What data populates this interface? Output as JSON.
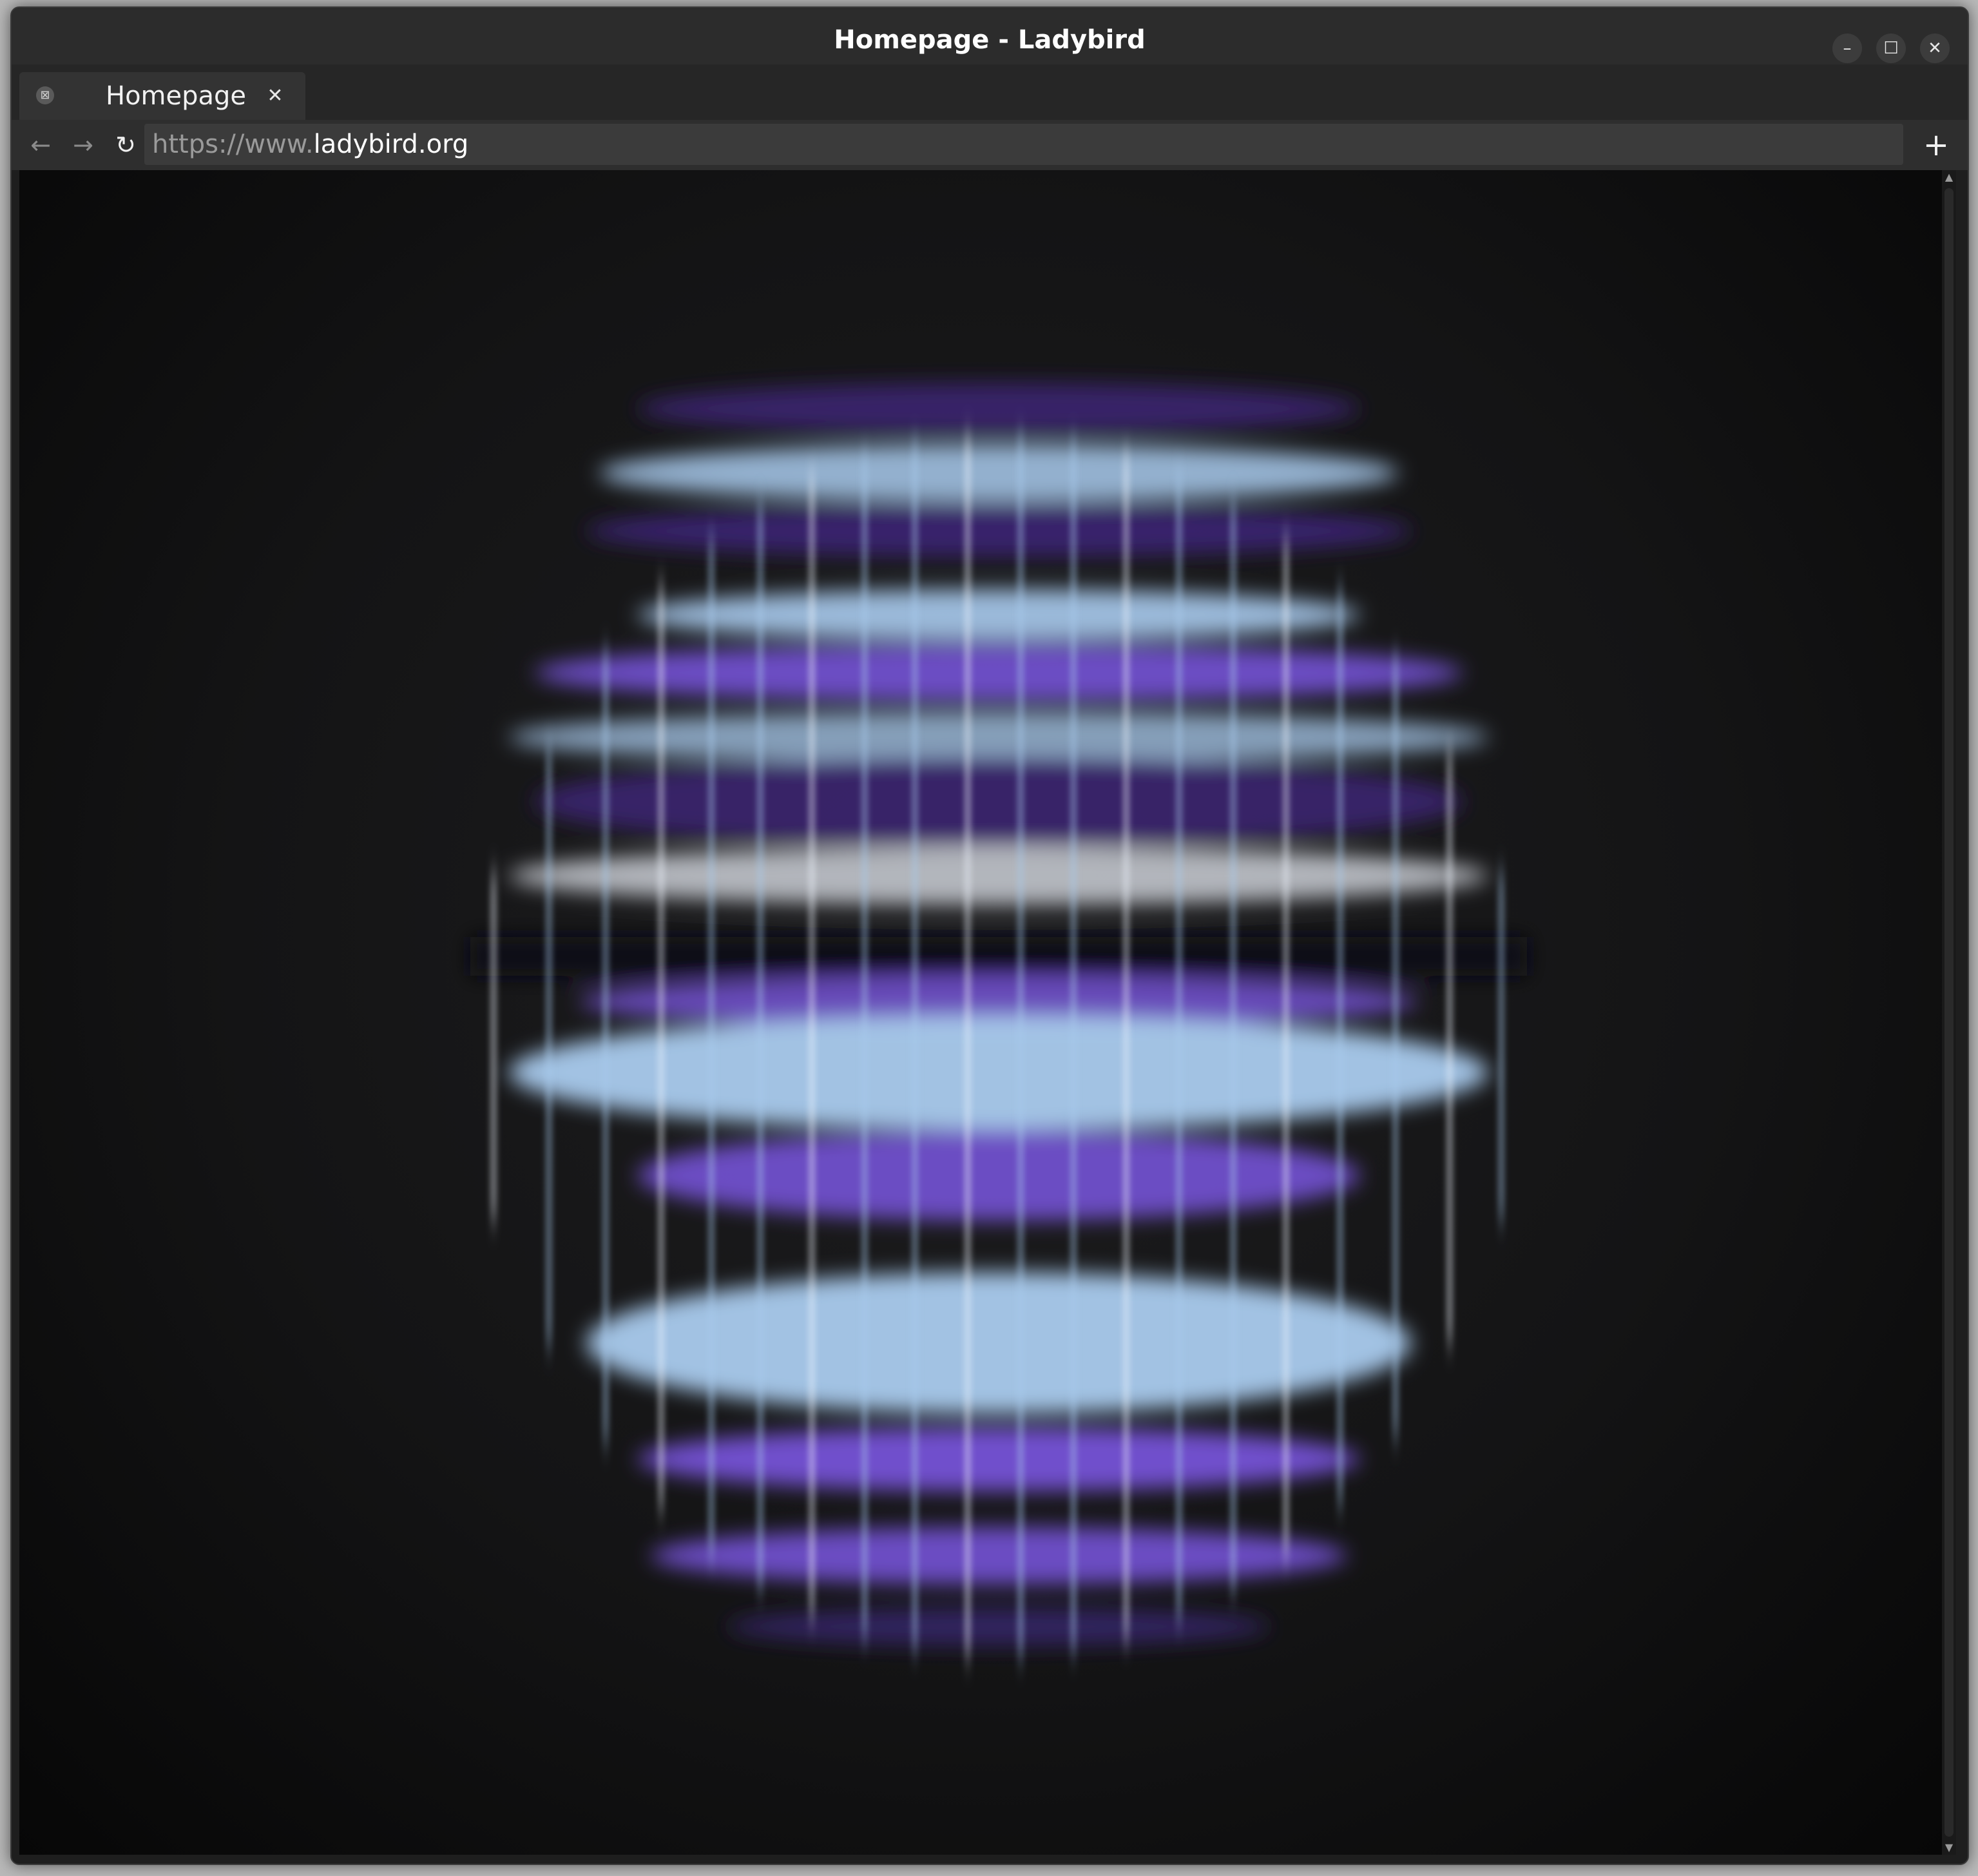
{
  "window": {
    "title": "Homepage - Ladybird",
    "controls": {
      "minimize_icon": "minimize-icon",
      "maximize_icon": "maximize-icon",
      "close_icon": "close-icon"
    }
  },
  "tabs": [
    {
      "label": "Homepage",
      "active": true,
      "favicon": "page-favicon-icon"
    }
  ],
  "toolbar": {
    "back_icon": "arrow-left-icon",
    "forward_icon": "arrow-right-icon",
    "reload_icon": "reload-icon",
    "new_tab_icon": "plus-icon",
    "url_scheme": "https://www.",
    "url_domain": "ladybird.org"
  },
  "page": {
    "content": "animated striped purple and light-blue sphere artwork",
    "colors": {
      "background": "#141415",
      "deep_purple": "#3a2470",
      "purple": "#7a55e0",
      "light_blue": "#a9cbee",
      "white": "#f2f6ff"
    }
  }
}
